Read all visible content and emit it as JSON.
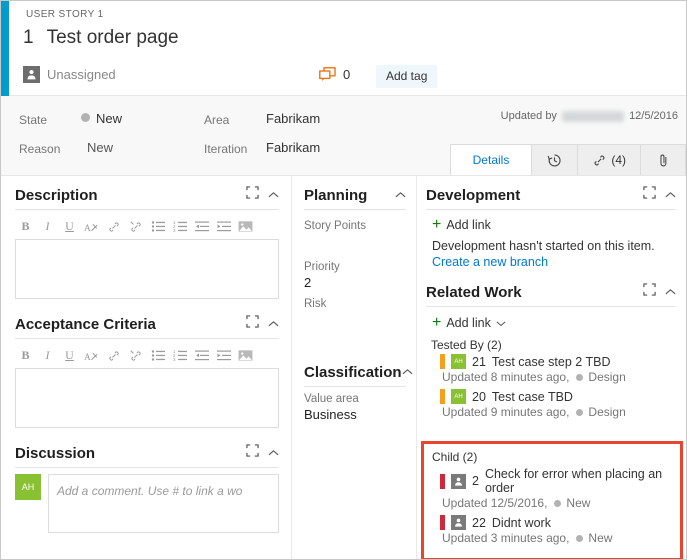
{
  "header": {
    "work_item_type": "USER STORY 1",
    "id": "1",
    "title": "Test order page",
    "assigned_to": "Unassigned",
    "assigned_icon": "person-icon",
    "comment_icon": "comment-icon",
    "comment_count": "0",
    "add_tag_label": "Add tag",
    "accent_color": "#009ccc"
  },
  "fields": {
    "state_label": "State",
    "state_value": "New",
    "reason_label": "Reason",
    "reason_value": "New",
    "area_label": "Area",
    "area_value": "Fabrikam",
    "iteration_label": "Iteration",
    "iteration_value": "Fabrikam",
    "updated_prefix": "Updated by",
    "updated_user": "Alex Homer",
    "updated_date": "12/5/2016"
  },
  "tabs": [
    {
      "label": "Details",
      "icon": "",
      "active": true
    },
    {
      "label": "",
      "icon": "history-clock-icon",
      "active": false
    },
    {
      "label": "(4)",
      "icon": "link-icon",
      "active": false
    },
    {
      "label": "",
      "icon": "paperclip-icon",
      "active": false
    }
  ],
  "description": {
    "title": "Description",
    "expand_icon": "expand-icon",
    "collapse_icon": "chevron-up-icon",
    "value": "",
    "toolbar": [
      "bold-icon",
      "italic-icon",
      "underline-icon",
      "clear-format-icon",
      "link-icon",
      "unlink-icon",
      "bullet-list-icon",
      "numbered-list-icon",
      "outdent-icon",
      "indent-icon",
      "image-icon"
    ]
  },
  "acceptance": {
    "title": "Acceptance Criteria",
    "expand_icon": "expand-icon",
    "collapse_icon": "chevron-up-icon",
    "value": ""
  },
  "discussion": {
    "title": "Discussion",
    "expand_icon": "expand-icon",
    "collapse_icon": "chevron-up-icon",
    "avatar_initials": "AH",
    "placeholder": "Add a comment. Use # to link a wo",
    "value": ""
  },
  "planning": {
    "title": "Planning",
    "collapse_icon": "chevron-up-icon",
    "story_points_label": "Story Points",
    "story_points_value": "",
    "priority_label": "Priority",
    "priority_value": "2",
    "risk_label": "Risk",
    "risk_value": ""
  },
  "classification": {
    "title": "Classification",
    "collapse_icon": "chevron-up-icon",
    "value_area_label": "Value area",
    "value_area_value": "Business"
  },
  "development": {
    "title": "Development",
    "expand_icon": "expand-icon",
    "collapse_icon": "chevron-up-icon",
    "add_link_label": "Add link",
    "status_text": "Development hasn't started on this item.",
    "branch_link": "Create a new branch"
  },
  "related_work": {
    "title": "Related Work",
    "expand_icon": "expand-icon",
    "collapse_icon": "chevron-up-icon",
    "add_link_label": "Add link",
    "add_link_chevron": "chevron-down-icon",
    "groups": [
      {
        "name": "Tested By (2)",
        "highlighted": false,
        "items": [
          {
            "type_color": "#f2a01e",
            "avatar_kind": "green",
            "avatar_initials": "AH",
            "id": "21",
            "title": "Test case step 2 TBD",
            "updated": "Updated 8 minutes ago,",
            "state": "Design"
          },
          {
            "type_color": "#f2a01e",
            "avatar_kind": "green",
            "avatar_initials": "AH",
            "id": "20",
            "title": "Test case TBD",
            "updated": "Updated 9 minutes ago,",
            "state": "Design"
          }
        ]
      },
      {
        "name": "Child (2)",
        "highlighted": true,
        "highlight_color": "#e8442f",
        "items": [
          {
            "type_color": "#cc293d",
            "avatar_kind": "gray",
            "avatar_initials": "",
            "id": "2",
            "title": "Check for error when placing an order",
            "updated": "Updated 12/5/2016,",
            "state": "New"
          },
          {
            "type_color": "#cc293d",
            "avatar_kind": "gray",
            "avatar_initials": "",
            "id": "22",
            "title": "Didnt work",
            "updated": "Updated 3 minutes ago,",
            "state": "New"
          }
        ]
      }
    ]
  }
}
